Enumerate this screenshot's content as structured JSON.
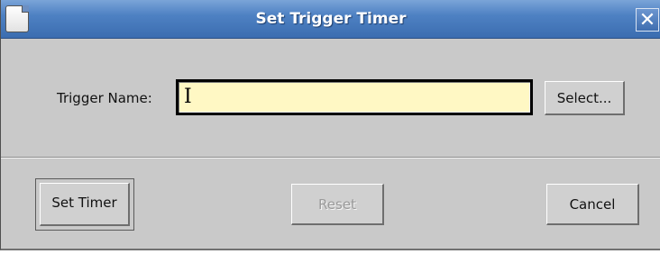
{
  "window": {
    "title": "Set Trigger Timer",
    "close_glyph": "✕"
  },
  "form": {
    "trigger_name_label": "Trigger Name:",
    "trigger_name_value": "",
    "trigger_name_placeholder": "",
    "select_button_label": "Select..."
  },
  "actions": {
    "set_timer_label": "Set Timer",
    "reset_label": "Reset",
    "reset_enabled": false,
    "cancel_label": "Cancel"
  },
  "colors": {
    "titlebar": "#4e81c3",
    "input_background": "#fff8c4",
    "dialog_background": "#c9c9c9"
  },
  "icons": {
    "system_menu": "window-menu-icon",
    "close": "close-icon",
    "text_cursor": "i-beam-cursor-icon"
  }
}
